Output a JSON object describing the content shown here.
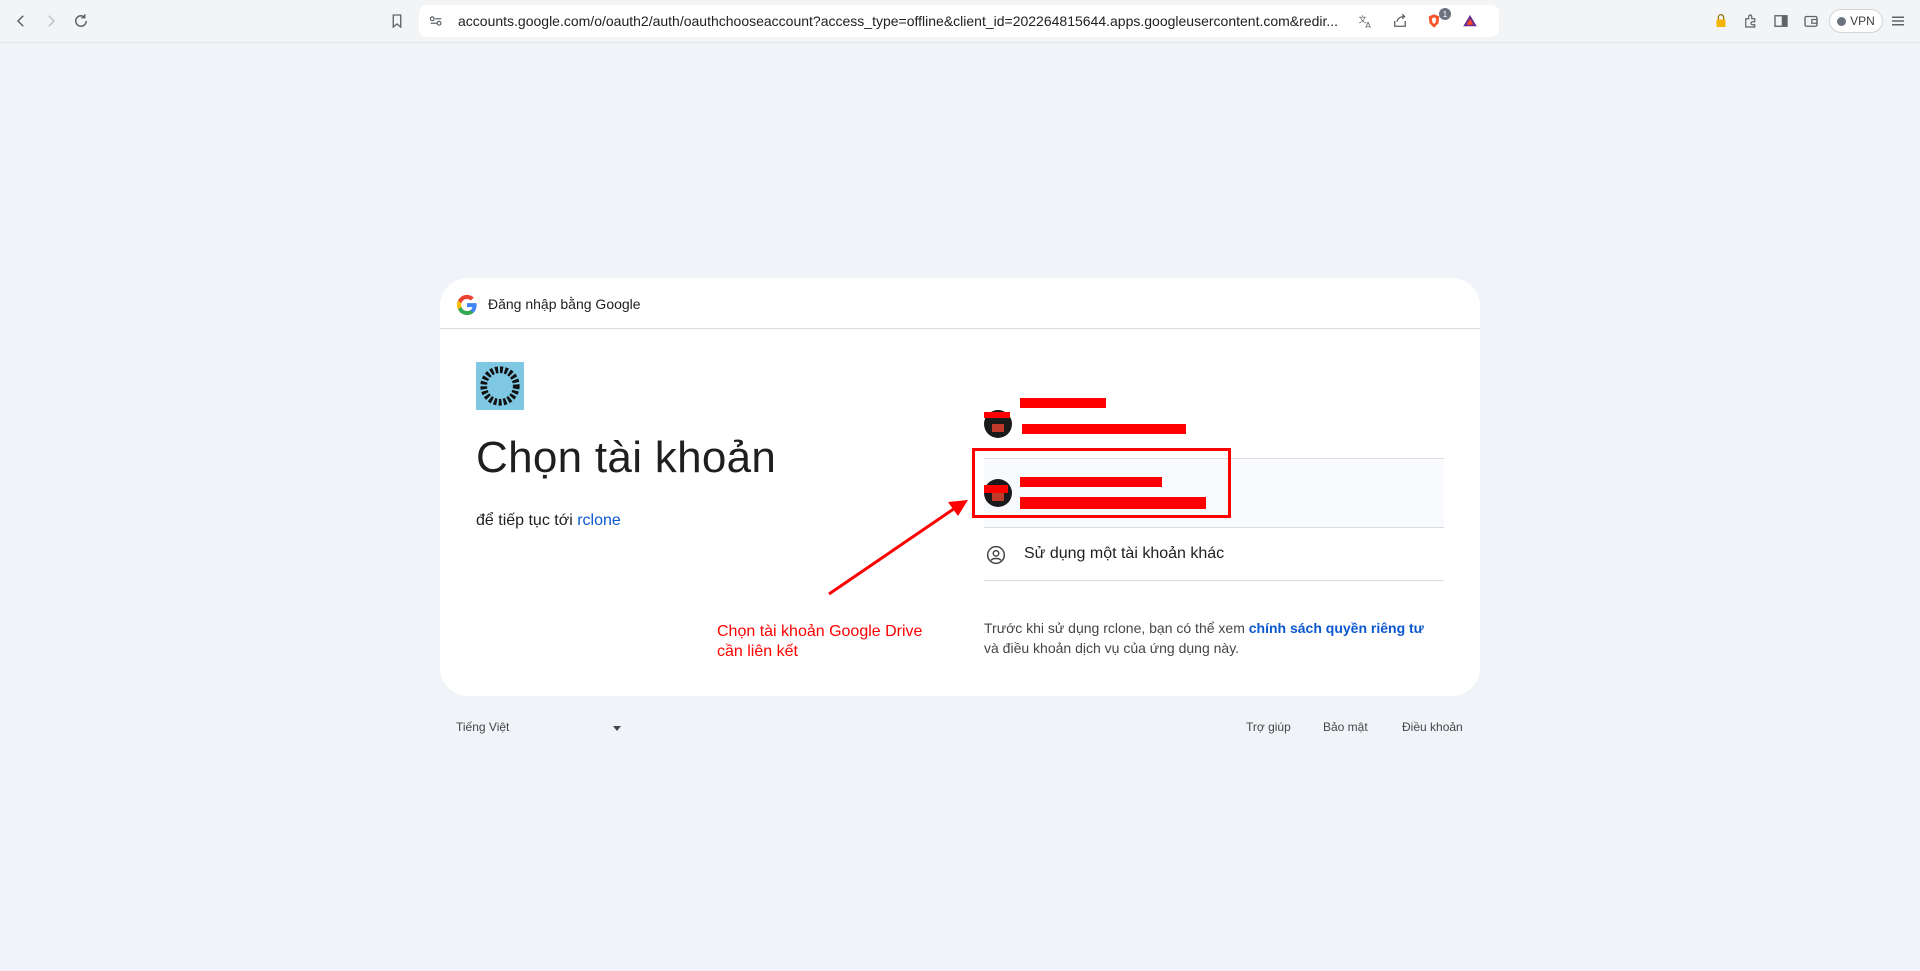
{
  "browser": {
    "url": "accounts.google.com/o/oauth2/auth/oauthchooseaccount?access_type=offline&client_id=202264815644.apps.googleusercontent.com&redir...",
    "vpn_label": "VPN",
    "shield_badge": "1"
  },
  "card": {
    "header_text": "Đăng nhập bằng Google",
    "title": "Chọn tài khoản",
    "subtitle_prefix": "để tiếp tục tới ",
    "app_link": "rclone",
    "accounts": [
      {
        "name": "",
        "email": ""
      },
      {
        "name": "",
        "email": ""
      }
    ],
    "use_other_account": "Sử dụng một tài khoản khác",
    "privacy_prefix": "Trước khi sử dụng rclone, bạn có thể xem ",
    "privacy_link": "chính sách quyền riêng tư",
    "privacy_suffix": "và điều khoản dịch vụ của ứng dụng này."
  },
  "footer": {
    "language": "Tiếng Việt",
    "help": "Trợ giúp",
    "privacy": "Bảo mật",
    "terms": "Điều khoản"
  },
  "annotation": {
    "line1": "Chọn tài khoản Google Drive",
    "line2": "cần liên kết",
    "color": "#ff0000"
  },
  "colors": {
    "page_bg": "#f0f4f9",
    "link": "#0b57d0"
  }
}
